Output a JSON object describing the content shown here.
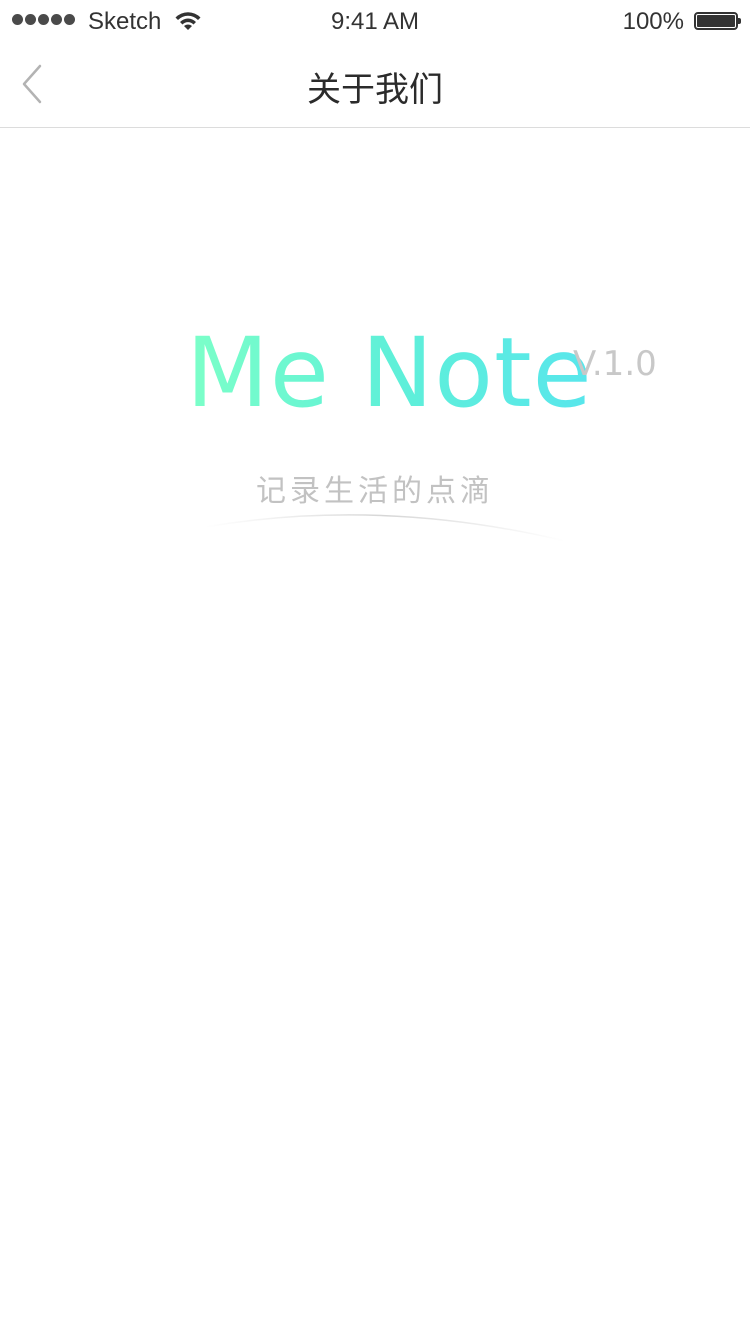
{
  "status_bar": {
    "carrier": "Sketch",
    "time": "9:41 AM",
    "battery_percent": "100%",
    "battery_level": 1.0,
    "signal_bars": 5
  },
  "nav": {
    "title": "关于我们",
    "back_icon": "chevron-left-icon"
  },
  "about": {
    "app_name": "Me Note",
    "version": "V.1.0",
    "slogan": "记录生活的点滴"
  },
  "colors": {
    "logo_gradient_start": "#7cffc8",
    "logo_gradient_end": "#58e6ec",
    "version_text": "#c8c8c8",
    "slogan_text": "#c2c2c2",
    "divider": "#dcdcdc"
  }
}
